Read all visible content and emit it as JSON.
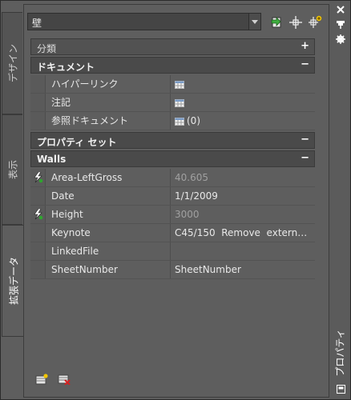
{
  "window": {
    "title": "プロパティ"
  },
  "tabs": [
    {
      "label": "デザイン",
      "active": false
    },
    {
      "label": "表示",
      "active": false
    },
    {
      "label": "拡張データ",
      "active": true
    }
  ],
  "object_selector": {
    "value": "壁"
  },
  "toolbar_icons": [
    "select-objects-icon",
    "pick-point-icon",
    "toggle-pickadd-icon"
  ],
  "window_controls": [
    "close-icon",
    "auto-hide-icon",
    "settings-icon"
  ],
  "sections": {
    "classification": {
      "label": "分類",
      "toggle": "+"
    },
    "documents": {
      "label": "ドキュメント",
      "toggle": "−"
    },
    "property_sets": {
      "label": "プロパティ セット",
      "toggle": "−"
    },
    "walls": {
      "label": "Walls",
      "toggle": "−"
    }
  },
  "document_rows": [
    {
      "name": "ハイパーリンク",
      "value": ""
    },
    {
      "name": "注記",
      "value": ""
    },
    {
      "name": "参照ドキュメント",
      "value": "(0)"
    }
  ],
  "wall_rows": [
    {
      "name": "Area-LeftGross",
      "value": "40.605",
      "readonly": true,
      "icon": "formula-icon"
    },
    {
      "name": "Date",
      "value": "1/1/2009",
      "readonly": false,
      "icon": ""
    },
    {
      "name": "Height",
      "value": "3000",
      "readonly": true,
      "icon": "formula-icon"
    },
    {
      "name": "Keynote",
      "value": "C45/150  Remove  extern…",
      "readonly": false,
      "icon": ""
    },
    {
      "name": "LinkedFile",
      "value": "",
      "readonly": false,
      "icon": ""
    },
    {
      "name": "SheetNumber",
      "value": "SheetNumber",
      "readonly": false,
      "icon": ""
    }
  ],
  "bottom_icons": [
    "add-property-set-icon",
    "remove-property-set-icon"
  ],
  "colors": {
    "panel": "#5e5e5e",
    "section_header": "#4a4a4a",
    "readonly_text": "#a0a0a0"
  }
}
